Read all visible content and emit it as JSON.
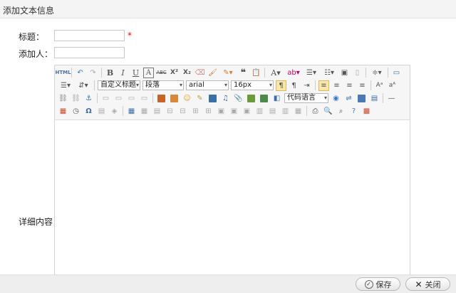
{
  "window": {
    "title": "添加文本信息"
  },
  "form": {
    "title_label": "标题：",
    "title_value": "",
    "required_mark": "*",
    "author_label": "添加人：",
    "author_value": "",
    "content_label": "详细内容"
  },
  "toolbar": {
    "source_label": "HTML",
    "custom_title": "自定义标题",
    "paragraph": "段落",
    "font_family": "arial",
    "font_size": "16px",
    "code_language": "代码语言",
    "bold": "B",
    "italic": "I",
    "underline": "U",
    "border_text": "A",
    "strike": "ABC",
    "superscript": "X²",
    "subscript": "X₂",
    "quote": "❝",
    "font_color": "A",
    "special_char": "Ω"
  },
  "footer": {
    "save_label": "保存",
    "close_label": "关闭"
  }
}
